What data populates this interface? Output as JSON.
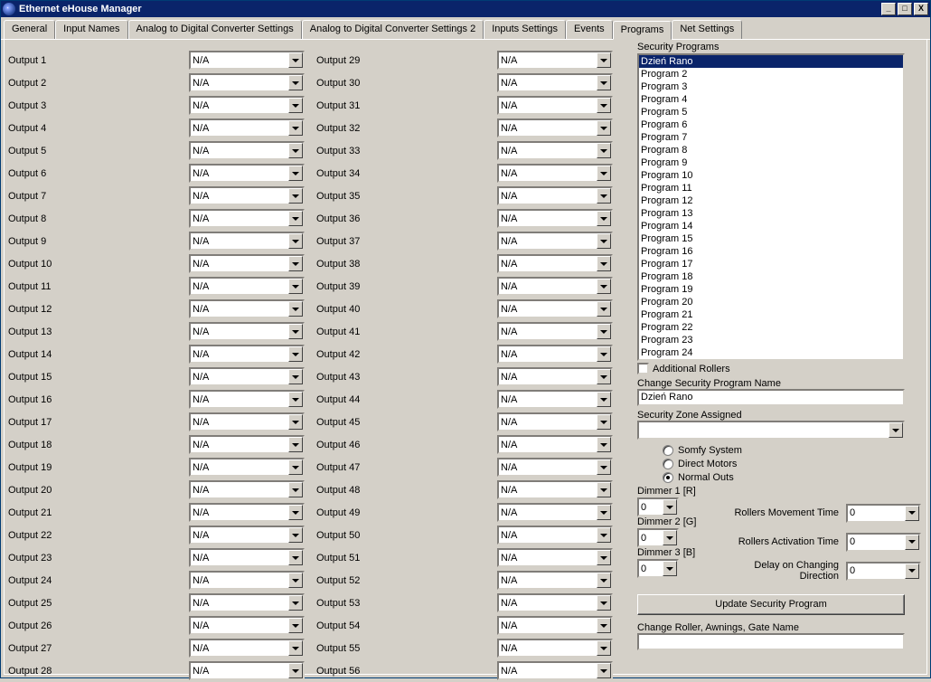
{
  "window": {
    "title": "Ethernet eHouse Manager"
  },
  "tabs": [
    "General",
    "Input Names",
    "Analog to Digital Converter Settings",
    "Analog to Digital Converter Settings 2",
    "Inputs Settings",
    "Events",
    "Programs",
    "Net Settings"
  ],
  "active_tab": 6,
  "output_value": "N/A",
  "outputs_left": [
    "Output 1",
    "Output 2",
    "Output 3",
    "Output 4",
    "Output 5",
    "Output 6",
    "Output 7",
    "Output 8",
    "Output 9",
    "Output 10",
    "Output 11",
    "Output 12",
    "Output 13",
    "Output 14",
    "Output 15",
    "Output 16",
    "Output 17",
    "Output 18",
    "Output 19",
    "Output 20",
    "Output 21",
    "Output 22",
    "Output 23",
    "Output 24",
    "Output 25",
    "Output 26",
    "Output 27",
    "Output 28"
  ],
  "outputs_right": [
    "Output 29",
    "Output 30",
    "Output 31",
    "Output 32",
    "Output 33",
    "Output 34",
    "Output 35",
    "Output 36",
    "Output 37",
    "Output 38",
    "Output 39",
    "Output 40",
    "Output 41",
    "Output 42",
    "Output 43",
    "Output 44",
    "Output 45",
    "Output 46",
    "Output 47",
    "Output 48",
    "Output 49",
    "Output 50",
    "Output 51",
    "Output 52",
    "Output 53",
    "Output 54",
    "Output 55",
    "Output 56"
  ],
  "right": {
    "security_programs_label": "Security Programs",
    "programs": [
      "Dzień Rano",
      "Program 2",
      "Program 3",
      "Program 4",
      "Program 5",
      "Program 6",
      "Program 7",
      "Program 8",
      "Program 9",
      "Program 10",
      "Program 11",
      "Program 12",
      "Program 13",
      "Program 14",
      "Program 15",
      "Program 16",
      "Program 17",
      "Program 18",
      "Program 19",
      "Program 20",
      "Program 21",
      "Program 22",
      "Program 23",
      "Program 24"
    ],
    "selected_program": 0,
    "additional_rollers_label": "Additional Rollers",
    "change_name_label": "Change Security Program Name",
    "change_name_value": "Dzień Rano",
    "zone_label": "Security Zone Assigned",
    "zone_value": "",
    "radio": {
      "somfy": "Somfy System",
      "direct": "Direct Motors",
      "normal": "Normal Outs"
    },
    "radio_selected": "normal",
    "dimmers": [
      {
        "label": "Dimmer 1 [R]",
        "value": "0"
      },
      {
        "label": "Dimmer 2 [G]",
        "value": "0"
      },
      {
        "label": "Dimmer 3 [B]",
        "value": "0"
      }
    ],
    "params": [
      {
        "label": "Rollers Movement Time",
        "value": "0"
      },
      {
        "label": "Rollers Activation Time",
        "value": "0"
      },
      {
        "label": "Delay on Changing Direction",
        "value": "0"
      }
    ],
    "update_btn": "Update Security Program",
    "change_roller_label": "Change Roller, Awnings, Gate Name",
    "change_roller_value": ""
  }
}
